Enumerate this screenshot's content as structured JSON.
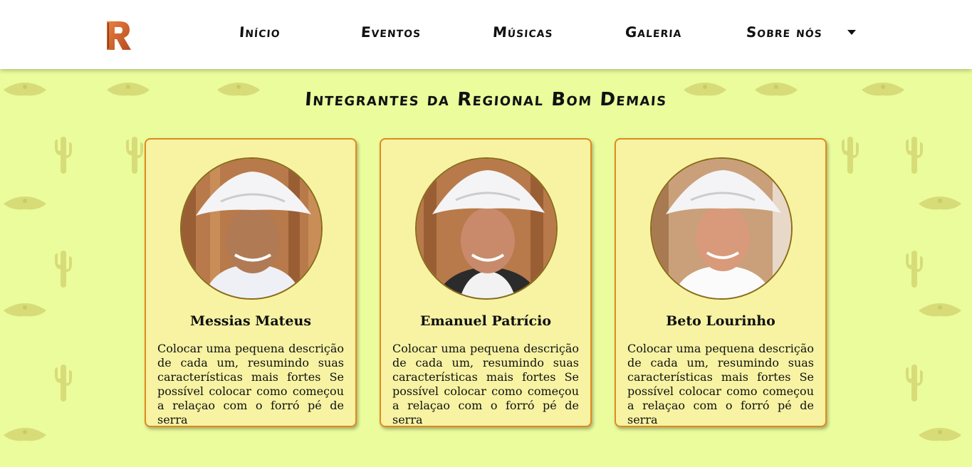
{
  "app": {
    "logo_letter": "R"
  },
  "nav": {
    "items": [
      {
        "label": "Início"
      },
      {
        "label": "Eventos"
      },
      {
        "label": "Músicas"
      },
      {
        "label": "Galeria"
      },
      {
        "label": "Sobre nós"
      }
    ],
    "dropdown_icon": "caret-down-icon"
  },
  "page": {
    "title": "Integrantes da Regional Bom Demais"
  },
  "members": [
    {
      "name": "Messias Mateus",
      "description": "Colocar uma pequena descrição de cada um, resumindo suas características mais fortes Se possível colocar como começou a relaçao com o forró pé de serra"
    },
    {
      "name": "Emanuel Patrício",
      "description": "Colocar uma pequena descrição de cada um, resumindo suas características mais fortes Se possível colocar como começou a relaçao com o forró pé de serra"
    },
    {
      "name": "Beto Lourinho",
      "description": "Colocar uma pequena descrição de cada um, resumindo suas características mais fortes Se possível colocar como começou a relaçao com o forró pé de serra"
    }
  ],
  "colors": {
    "background": "#eafc9c",
    "card_bg": "#f7f3a3",
    "card_border": "#e08a1e",
    "logo": "#d9652a"
  }
}
